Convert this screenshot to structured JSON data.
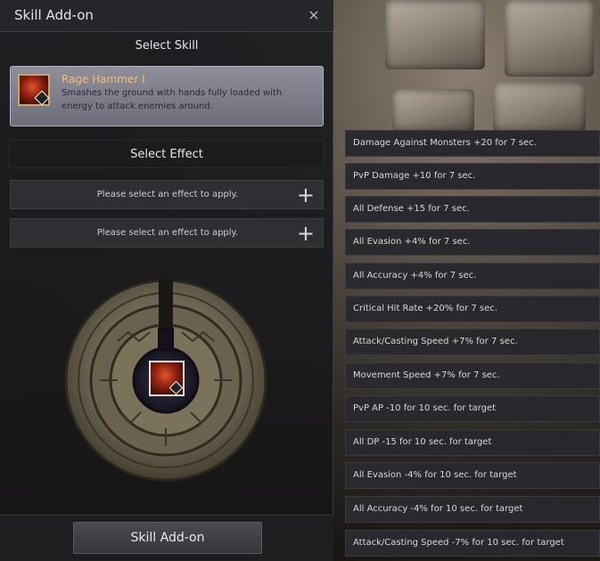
{
  "window": {
    "title": "Skill Add-on",
    "close_label": "×"
  },
  "select_skill": {
    "heading": "Select Skill"
  },
  "skill": {
    "name": "Rage Hammer I",
    "description": "Smashes the ground with hands fully loaded with energy to attack enemies around."
  },
  "select_effect": {
    "heading": "Select Effect",
    "slots": [
      {
        "text": "Please select an effect to apply.",
        "plus": "+"
      },
      {
        "text": "Please select an effect to apply.",
        "plus": "+"
      }
    ]
  },
  "action": {
    "button_label": "Skill Add-on"
  },
  "effects": [
    "Damage Against Monsters +20 for 7 sec.",
    "PvP Damage +10 for 7 sec.",
    "All Defense +15 for 7 sec.",
    "All Evasion +4% for 7 sec.",
    "All Accuracy +4% for 7 sec.",
    "Critical Hit Rate +20% for 7 sec.",
    "Attack/Casting Speed +7% for 7 sec.",
    "Movement Speed +7% for 7 sec.",
    "PvP AP -10 for 10 sec. for target",
    "All DP -15 for 10 sec. for target",
    "All Evasion -4% for 10 sec. for target",
    "All Accuracy -4% for 10 sec. for target",
    "Attack/Casting Speed -7% for 10 sec. for target"
  ],
  "colors": {
    "skill_name": "#f0c070",
    "panel": "#1e1e22",
    "card": "#7d7c89"
  }
}
